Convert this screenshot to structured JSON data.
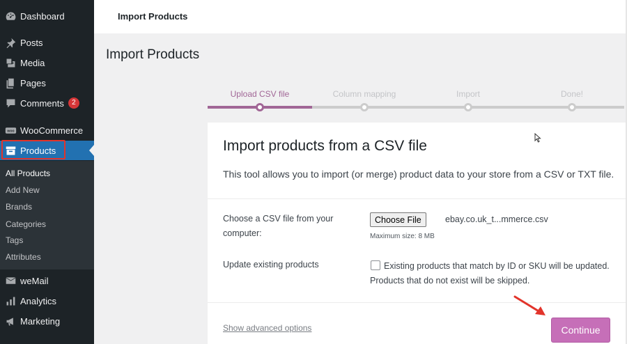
{
  "sidebar": {
    "items": [
      {
        "label": "Dashboard",
        "icon": "dashboard-icon"
      },
      {
        "label": "Posts",
        "icon": "pin-icon"
      },
      {
        "label": "Media",
        "icon": "media-icon"
      },
      {
        "label": "Pages",
        "icon": "pages-icon"
      },
      {
        "label": "Comments",
        "icon": "comment-icon",
        "badge": "2"
      },
      {
        "label": "WooCommerce",
        "icon": "woo-icon"
      },
      {
        "label": "Products",
        "icon": "archive-icon"
      },
      {
        "label": "weMail",
        "icon": "mail-icon"
      },
      {
        "label": "Analytics",
        "icon": "bar-chart-icon"
      },
      {
        "label": "Marketing",
        "icon": "megaphone-icon"
      }
    ],
    "submenu": [
      "All Products",
      "Add New",
      "Brands",
      "Categories",
      "Tags",
      "Attributes"
    ]
  },
  "header": {
    "title": "Import Products"
  },
  "page": {
    "title": "Import Products"
  },
  "steps": [
    {
      "label": "Upload CSV file",
      "state": "current"
    },
    {
      "label": "Column mapping",
      "state": "pending"
    },
    {
      "label": "Import",
      "state": "pending"
    },
    {
      "label": "Done!",
      "state": "pending"
    }
  ],
  "card": {
    "heading": "Import products from a CSV file",
    "description": "This tool allows you to import (or merge) product data to your store from a CSV or TXT file.",
    "file_label_line1": "Choose a CSV file from your",
    "file_label_line2": "computer:",
    "choose_file_label": "Choose File",
    "file_name": "ebay.co.uk_t...mmerce.csv",
    "max_size": "Maximum size: 8 MB",
    "update_label": "Update existing products",
    "update_text_line1": "Existing products that match by ID or SKU will be updated.",
    "update_text_line2": "Products that do not exist will be skipped.",
    "advanced_link": "Show advanced options",
    "continue_label": "Continue"
  },
  "colors": {
    "accent": "#a16696",
    "button": "#c66fb8",
    "sidebar": "#1d2327",
    "active": "#2271b1",
    "annotation": "#e2342b"
  }
}
